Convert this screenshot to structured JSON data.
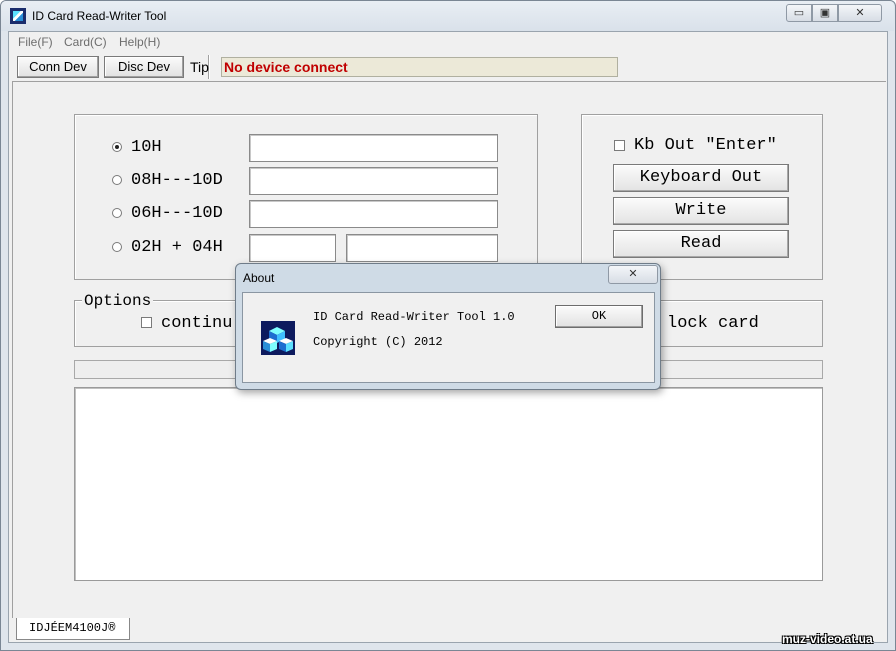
{
  "window": {
    "title": "ID Card Read-Writer Tool",
    "controls": {
      "minimize": "▭",
      "maximize": "▣",
      "close": "✕"
    }
  },
  "menu": [
    "File(F)",
    "Card(C)",
    "Help(H)"
  ],
  "toolbar": {
    "conn_label": "Conn Dev",
    "disc_label": "Disc Dev",
    "tip_label": "Tip",
    "tip_value": "No device connect"
  },
  "formats": [
    {
      "label": "10H",
      "selected": true
    },
    {
      "label": "08H---10D",
      "selected": false
    },
    {
      "label": "06H---10D",
      "selected": false
    },
    {
      "label": "02H + 04H",
      "selected": false
    }
  ],
  "output": {
    "kb_enter_label": "Kb Out \"Enter\"",
    "keyboard_out_label": "Keyboard Out",
    "write_label": "Write",
    "read_label": "Read"
  },
  "options": {
    "legend": "Options",
    "continue_label": "continu",
    "lock_label": "lock card"
  },
  "tab_label": "IDJÉEM4100J®",
  "watermark": "muz-video.at.ua",
  "about": {
    "title": "About",
    "close": "✕",
    "line1": "ID Card Read-Writer Tool 1.0",
    "line2": "Copyright (C) 2012",
    "ok_label": "OK"
  },
  "colors": {
    "tip_text": "#c00000",
    "tip_bg": "#ece9d8",
    "frame": "#dfe5ec"
  }
}
